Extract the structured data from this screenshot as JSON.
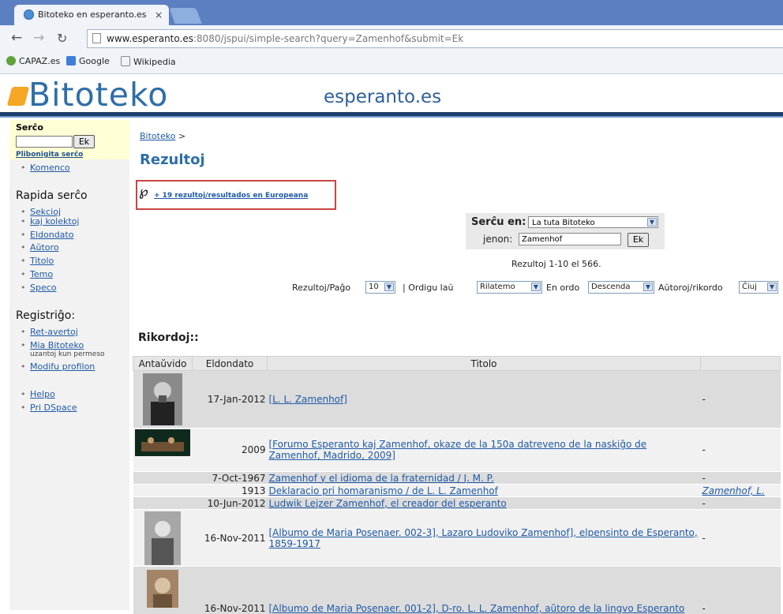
{
  "browser": {
    "tab_title": "Bitoteko en esperanto.es",
    "tab_close": "×",
    "url_host": "www.esperanto.es",
    "url_rest": ":8080/jspui/simple-search?query=Zamenhof&submit=Ek",
    "bookmarks": [
      {
        "label": "CAPAZ.es"
      },
      {
        "label": "Google"
      },
      {
        "label": "Wikipedia"
      }
    ]
  },
  "header": {
    "logo": "Bitoteko",
    "tagline": "esperanto.es"
  },
  "sidebar": {
    "search_title": "Serĉo",
    "search_button": "Ek",
    "advanced": "Plibonigita serĉo",
    "home": "Komenco",
    "quick_title": "Rapida serĉo",
    "quick_items": [
      {
        "label": "Sekcioj"
      },
      {
        "label": "kaj kolektoj"
      },
      {
        "label": "Eldondato"
      },
      {
        "label": "Aŭtoro"
      },
      {
        "label": "Titolo"
      },
      {
        "label": "Temo"
      },
      {
        "label": "Speco"
      }
    ],
    "register_title": "Registriĝo:",
    "register_items": [
      {
        "label": "Ret-avertoj"
      },
      {
        "label": "Mia Bitoteko"
      },
      {
        "label": "Modifu profilon"
      }
    ],
    "register_note": "uzantoj kun permeso",
    "help_items": [
      {
        "label": "Helpo"
      },
      {
        "label": "Pri DSpace"
      }
    ]
  },
  "main": {
    "breadcrumb_link": "Bitoteko",
    "breadcrumb_sep": ">",
    "title": "Rezultoj",
    "europeana_link": "+ 19 rezultoj/resultados en Europeana",
    "scope_label": "Serĉu en:",
    "scope_value": "La tuta Bitoteko",
    "for_label": "jenon:",
    "query": "Zamenhof",
    "go_button": "Ek",
    "range": "Rezultoj 1-10 el 566.",
    "per_page_label": "Rezultoj/Paĝo",
    "per_page": "10",
    "sort_label": "| Ordigu laŭ",
    "sort_value": "Rilatemo",
    "order_label": "En ordo",
    "order_value": "Descenda",
    "authors_label": "Aŭtoroj/rikordo",
    "authors_value": "Ĉiuj",
    "records_title": "Rikordoj::"
  },
  "table": {
    "headers": [
      "Antaŭvido",
      "Eldondato",
      "Titolo",
      ""
    ],
    "rows": [
      {
        "date": "17-Jan-2012",
        "title": "[L. L. Zamenhof]",
        "author": "-"
      },
      {
        "date": "2009",
        "title": "[Forumo Esperanto kaj Zamenhof, okaze de la 150a datreveno de la naskiĝo de Zamenhof, Madrido, 2009]",
        "author": "-"
      },
      {
        "date": "7-Oct-1967",
        "title": "Zamenhof y el idioma de la fraternidad / J. M. P.",
        "author": "-"
      },
      {
        "date": "1913",
        "title": "Deklaracio pri homaranismo / de L. L. Zamenhof",
        "author": "Zamenhof, L."
      },
      {
        "date": "10-Jun-2012",
        "title": "Ludwik Lejzer Zamenhof, el creador del esperanto",
        "author": "-"
      },
      {
        "date": "16-Nov-2011",
        "title": "[Albumo de Maria Posenaer. 002-3], Lazaro Ludoviko Zamenhof], elpensinto de Esperanto, 1859-1917",
        "author": "-"
      },
      {
        "date": "16-Nov-2011",
        "title": "[Albumo de Maria Posenaer. 001-2], D-ro. L. L. Zamenhof, aŭtoro de la lingvo Esperanto",
        "author": "-"
      }
    ]
  },
  "colors": {
    "link": "#1f5aa6",
    "brand": "#2f6ea8",
    "header_bar": "#1c3d6b",
    "europeana_border": "#c94444"
  }
}
